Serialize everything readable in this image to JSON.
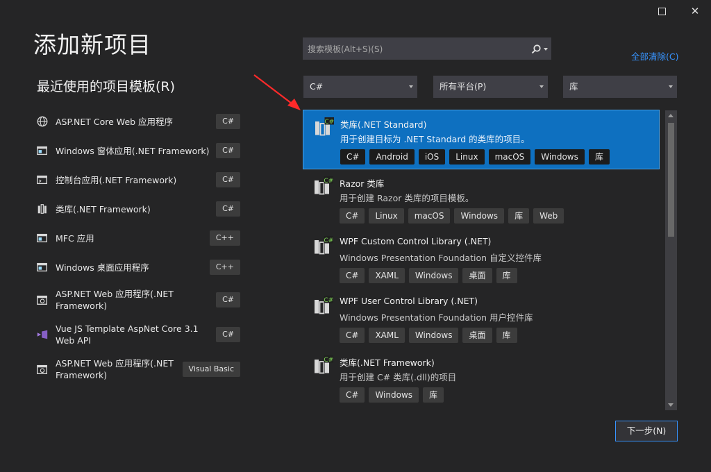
{
  "window": {
    "maximize_icon": "maximize-icon",
    "close_icon": "close-icon",
    "close_glyph": "✕"
  },
  "title": "添加新项目",
  "recent": {
    "heading": "最近使用的项目模板(R)",
    "items": [
      {
        "label": "ASP.NET Core Web 应用程序",
        "lang": "C#",
        "icon": "globe-icon"
      },
      {
        "label": "Windows 窗体应用(.NET Framework)",
        "lang": "C#",
        "icon": "window-icon"
      },
      {
        "label": "控制台应用(.NET Framework)",
        "lang": "C#",
        "icon": "console-icon"
      },
      {
        "label": "类库(.NET Framework)",
        "lang": "C#",
        "icon": "library-icon"
      },
      {
        "label": "MFC 应用",
        "lang": "C++",
        "icon": "mfc-icon"
      },
      {
        "label": "Windows 桌面应用程序",
        "lang": "C++",
        "icon": "desktop-app-icon"
      },
      {
        "label": "ASP.NET Web 应用程序(.NET Framework)",
        "lang": "C#",
        "icon": "web-app-icon"
      },
      {
        "label": "Vue JS Template AspNet Core 3.1 Web API",
        "lang": "C#",
        "icon": "vs-icon"
      },
      {
        "label": "ASP.NET Web 应用程序(.NET Framework)",
        "lang": "Visual Basic",
        "icon": "web-app-icon"
      }
    ]
  },
  "search": {
    "placeholder": "搜索模板(Alt+S)(S)",
    "icon": "search-icon"
  },
  "clear_all": "全部清除(C)",
  "filters": {
    "language": "C#",
    "platform": "所有平台(P)",
    "project_type": "库"
  },
  "templates": [
    {
      "name": "类库(.NET Standard)",
      "desc": "用于创建目标为 .NET Standard 的类库的项目。",
      "tags": [
        "C#",
        "Android",
        "iOS",
        "Linux",
        "macOS",
        "Windows",
        "库"
      ],
      "selected": true,
      "icon": "class-library-icon"
    },
    {
      "name": "Razor 类库",
      "desc": "用于创建 Razor 类库的项目模板。",
      "tags": [
        "C#",
        "Linux",
        "macOS",
        "Windows",
        "库",
        "Web"
      ],
      "selected": false,
      "icon": "razor-library-icon"
    },
    {
      "name": "WPF Custom Control Library (.NET)",
      "desc": "Windows Presentation Foundation 自定义控件库",
      "tags": [
        "C#",
        "XAML",
        "Windows",
        "桌面",
        "库"
      ],
      "selected": false,
      "icon": "wpf-custom-control-icon"
    },
    {
      "name": "WPF User Control Library (.NET)",
      "desc": "Windows Presentation Foundation 用户控件库",
      "tags": [
        "C#",
        "XAML",
        "Windows",
        "桌面",
        "库"
      ],
      "selected": false,
      "icon": "wpf-user-control-icon"
    },
    {
      "name": "类库(.NET Framework)",
      "desc": "用于创建 C# 类库(.dll)的项目",
      "tags": [
        "C#",
        "Windows",
        "库"
      ],
      "selected": false,
      "icon": "class-library-icon"
    }
  ],
  "next_button": "下一步(N)",
  "colors": {
    "background": "#252526",
    "selected": "#0e70c0",
    "accent": "#3794ff",
    "annotation": "#ff2a2a"
  }
}
